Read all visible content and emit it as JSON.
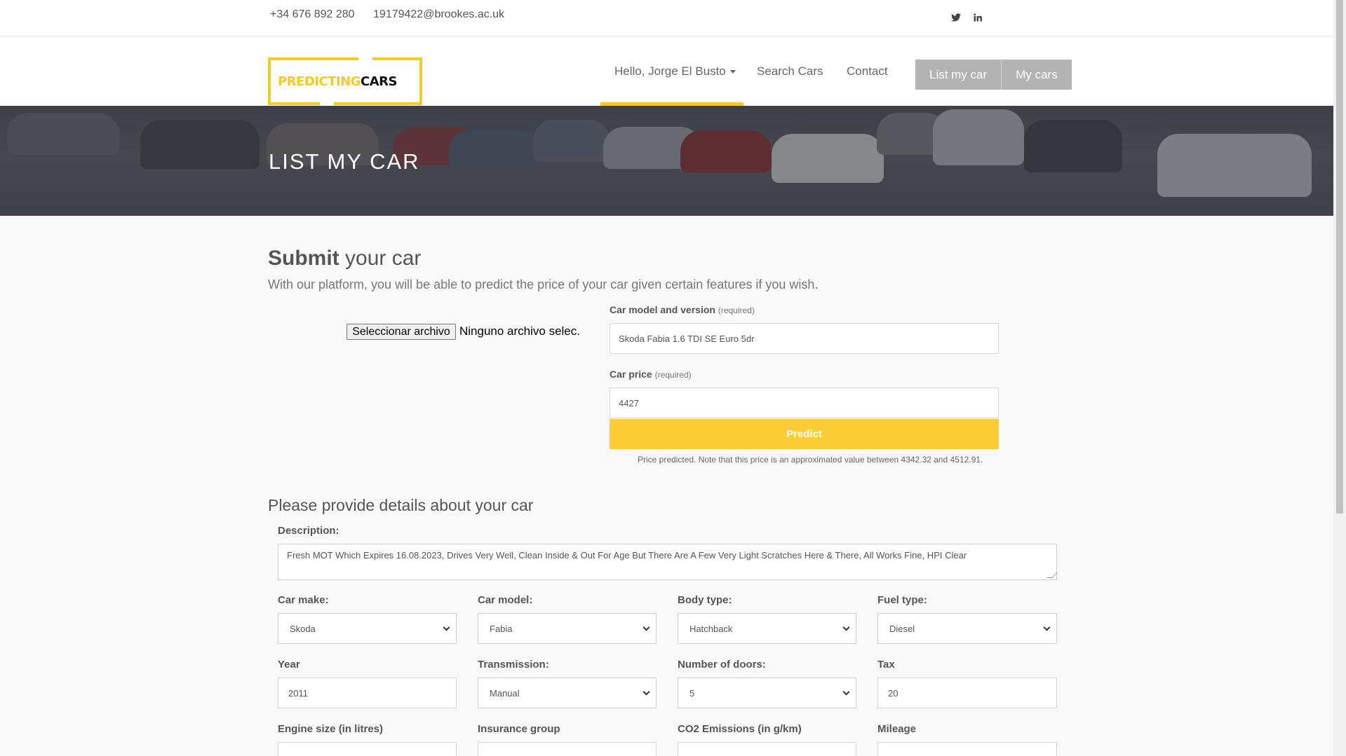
{
  "topbar": {
    "phone": "+34 676 892 280",
    "email": "19179422@brookes.ac.uk",
    "social": [
      "twitter-icon",
      "linkedin-icon"
    ]
  },
  "logo": {
    "part1": "PREDICTING",
    "part2": "CARS"
  },
  "nav": {
    "hello": "Hello, Jorge El Busto",
    "search": "Search Cars",
    "contact": "Contact",
    "list_my_car": "List my car",
    "my_cars": "My cars"
  },
  "banner": {
    "title": "LIST MY CAR"
  },
  "submit": {
    "title_bold": "Submit",
    "title_rest": " your car",
    "subtitle": "With our platform, you will be able to predict the price of your car given certain features if you wish.",
    "file_button": "Seleccionar archivo",
    "file_status": "Ninguno archivo selec.",
    "model_label": "Car model and version",
    "model_required": "(required)",
    "model_value": "Skoda Fabia 1.6 TDI SE Euro 5dr",
    "price_label": "Car price",
    "price_required": "(required)",
    "price_value": "4427",
    "predict_button": "Predict",
    "predict_note": "Price predicted. Note that this price is an approximated value between 4342.32 and 4512.91."
  },
  "details": {
    "title": "Please provide details about your car",
    "description_label": "Description:",
    "description": "Fresh MOT Which Expires 16.08.2023, Drives Very Well, Clean Inside & Out For Age But There Are A Few Very Light Scratches Here & There, All Works Fine, HPI Clear",
    "car_make_label": "Car make:",
    "car_make": "Skoda",
    "car_model_label": "Car model:",
    "car_model": "Fabia",
    "body_type_label": "Body type:",
    "body_type": "Hatchback",
    "fuel_type_label": "Fuel type:",
    "fuel_type": "Diesel",
    "year_label": "Year",
    "year": "2011",
    "transmission_label": "Transmission:",
    "transmission": "Manual",
    "doors_label": "Number of doors:",
    "doors": "5",
    "tax_label": "Tax",
    "tax": "20",
    "engine_label": "Engine size (in litres)",
    "insurance_label": "Insurance group",
    "co2_label": "CO2 Emissions (in g/km)",
    "mileage_label": "Mileage"
  }
}
